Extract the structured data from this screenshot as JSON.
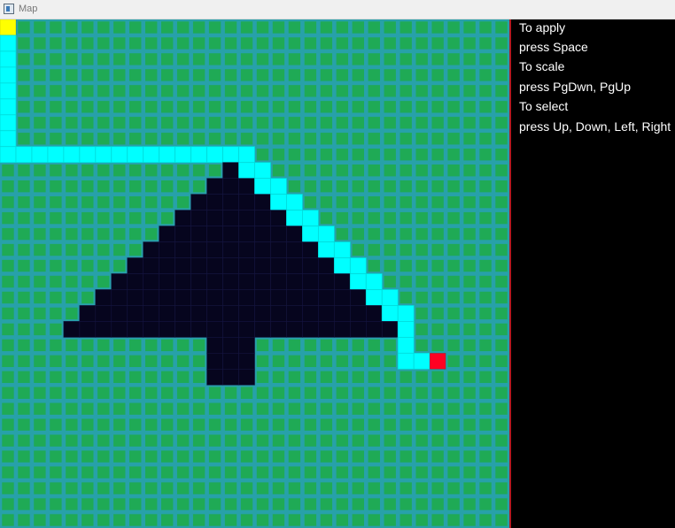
{
  "window": {
    "title": "Map",
    "icon": "window-icon"
  },
  "map": {
    "cols": 32,
    "rows": 32,
    "colors": {
      "grass": "#1faa55",
      "grid": "#27a1a9",
      "obstacle": "#06051e",
      "path": "#00ffff",
      "start": "#ffff00",
      "goal": "#ff0022"
    },
    "start": [
      0,
      0
    ],
    "goal": [
      27,
      21
    ],
    "obstacle_rows": [
      {
        "row": 9,
        "from": 14,
        "to": 14
      },
      {
        "row": 10,
        "from": 13,
        "to": 15
      },
      {
        "row": 11,
        "from": 12,
        "to": 16
      },
      {
        "row": 12,
        "from": 11,
        "to": 17
      },
      {
        "row": 13,
        "from": 10,
        "to": 18
      },
      {
        "row": 14,
        "from": 9,
        "to": 19
      },
      {
        "row": 15,
        "from": 8,
        "to": 20
      },
      {
        "row": 16,
        "from": 7,
        "to": 21
      },
      {
        "row": 17,
        "from": 6,
        "to": 22
      },
      {
        "row": 18,
        "from": 5,
        "to": 23
      },
      {
        "row": 19,
        "from": 4,
        "to": 24
      },
      {
        "row": 20,
        "from": 13,
        "to": 15
      },
      {
        "row": 21,
        "from": 13,
        "to": 15
      },
      {
        "row": 22,
        "from": 13,
        "to": 15
      }
    ],
    "path": [
      [
        0,
        1
      ],
      [
        0,
        2
      ],
      [
        0,
        3
      ],
      [
        0,
        4
      ],
      [
        0,
        5
      ],
      [
        0,
        6
      ],
      [
        0,
        7
      ],
      [
        0,
        8
      ],
      [
        1,
        8
      ],
      [
        2,
        8
      ],
      [
        3,
        8
      ],
      [
        4,
        8
      ],
      [
        5,
        8
      ],
      [
        6,
        8
      ],
      [
        7,
        8
      ],
      [
        8,
        8
      ],
      [
        9,
        8
      ],
      [
        10,
        8
      ],
      [
        11,
        8
      ],
      [
        12,
        8
      ],
      [
        13,
        8
      ],
      [
        14,
        8
      ],
      [
        15,
        8
      ],
      [
        15,
        9
      ],
      [
        16,
        9
      ],
      [
        16,
        10
      ],
      [
        17,
        10
      ],
      [
        17,
        11
      ],
      [
        18,
        11
      ],
      [
        18,
        12
      ],
      [
        19,
        12
      ],
      [
        19,
        13
      ],
      [
        20,
        13
      ],
      [
        20,
        14
      ],
      [
        21,
        14
      ],
      [
        21,
        15
      ],
      [
        22,
        15
      ],
      [
        22,
        16
      ],
      [
        23,
        16
      ],
      [
        23,
        17
      ],
      [
        24,
        17
      ],
      [
        24,
        18
      ],
      [
        25,
        18
      ],
      [
        25,
        19
      ],
      [
        25,
        20
      ],
      [
        25,
        21
      ],
      [
        26,
        21
      ]
    ]
  },
  "instructions": [
    "To apply",
    "press Space",
    "To scale",
    "press PgDwn, PgUp",
    "To select",
    "press Up, Down, Left, Right"
  ]
}
